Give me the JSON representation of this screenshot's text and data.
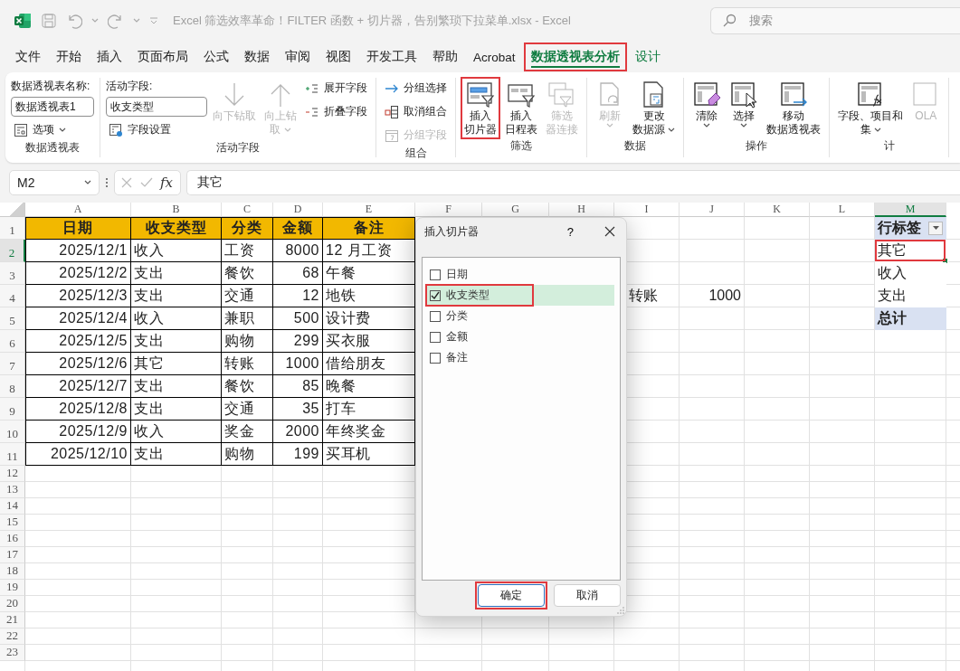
{
  "title_bar": {
    "title": "Excel 筛选效率革命！FILTER 函数 + 切片器，告别繁琐下拉菜单.xlsx  -  Excel",
    "search": {
      "placeholder": "搜索"
    }
  },
  "menu_tabs": [
    {
      "label": "文件",
      "selected": false,
      "contextual": false,
      "annotated": false
    },
    {
      "label": "开始",
      "selected": false,
      "contextual": false,
      "annotated": false
    },
    {
      "label": "插入",
      "selected": false,
      "contextual": false,
      "annotated": false
    },
    {
      "label": "页面布局",
      "selected": false,
      "contextual": false,
      "annotated": false
    },
    {
      "label": "公式",
      "selected": false,
      "contextual": false,
      "annotated": false
    },
    {
      "label": "数据",
      "selected": false,
      "contextual": false,
      "annotated": false
    },
    {
      "label": "审阅",
      "selected": false,
      "contextual": false,
      "annotated": false
    },
    {
      "label": "视图",
      "selected": false,
      "contextual": false,
      "annotated": false
    },
    {
      "label": "开发工具",
      "selected": false,
      "contextual": false,
      "annotated": false
    },
    {
      "label": "帮助",
      "selected": false,
      "contextual": false,
      "annotated": false
    },
    {
      "label": "Acrobat",
      "selected": false,
      "contextual": false,
      "annotated": false
    },
    {
      "label": "数据透视表分析",
      "selected": true,
      "contextual": true,
      "annotated": true
    },
    {
      "label": "设计",
      "selected": false,
      "contextual": true,
      "annotated": false
    }
  ],
  "ribbon": {
    "groups": [
      {
        "label": "数据透视表",
        "columns": [
          [
            {
              "kind": "caption",
              "label": "数据透视表名称:"
            },
            {
              "kind": "input",
              "value": "数据透视表1"
            },
            {
              "kind": "small",
              "label": "选项",
              "disabled": false,
              "dropdown": true
            }
          ]
        ]
      },
      {
        "label": "活动字段",
        "columns": [
          [
            {
              "kind": "caption",
              "label": "活动字段:"
            },
            {
              "kind": "input",
              "value": "收支类型"
            },
            {
              "kind": "small",
              "label": "字段设置",
              "disabled": false
            }
          ],
          [
            {
              "kind": "large",
              "lines": [
                "向下钻取"
              ],
              "disabled": true,
              "dropdown": false,
              "annotated": false
            }
          ],
          [
            {
              "kind": "large",
              "lines": [
                "向上钻",
                "取"
              ],
              "disabled": true,
              "dropdown": true,
              "annotated": false
            }
          ],
          [
            {
              "kind": "small",
              "label": "展开字段",
              "disabled": false
            },
            {
              "kind": "small",
              "label": "折叠字段",
              "disabled": false
            }
          ]
        ]
      },
      {
        "label": "组合",
        "columns": [
          [
            {
              "kind": "small",
              "label": "分组选择",
              "disabled": false
            },
            {
              "kind": "small",
              "label": "取消组合",
              "disabled": false
            },
            {
              "kind": "small",
              "label": "分组字段",
              "disabled": true
            }
          ]
        ]
      },
      {
        "label": "筛选",
        "columns": [
          [
            {
              "kind": "large",
              "lines": [
                "插入",
                "切片器"
              ],
              "disabled": false,
              "dropdown": false,
              "annotated": true
            }
          ],
          [
            {
              "kind": "large",
              "lines": [
                "插入",
                "日程表"
              ],
              "disabled": false,
              "dropdown": false,
              "annotated": false
            }
          ],
          [
            {
              "kind": "large",
              "lines": [
                "筛选",
                "器连接"
              ],
              "disabled": true,
              "dropdown": false,
              "annotated": false
            }
          ]
        ]
      },
      {
        "label": "数据",
        "columns": [
          [
            {
              "kind": "split",
              "lines": [
                "刷新"
              ],
              "disabled": true,
              "annotated": false
            }
          ],
          [
            {
              "kind": "large",
              "lines": [
                "更改",
                "数据源"
              ],
              "disabled": false,
              "dropdown": true,
              "annotated": false
            }
          ]
        ]
      },
      {
        "label": "操作",
        "columns": [
          [
            {
              "kind": "split",
              "lines": [
                "清除"
              ],
              "disabled": false,
              "annotated": false
            }
          ],
          [
            {
              "kind": "split",
              "lines": [
                "选择"
              ],
              "disabled": false,
              "annotated": false
            }
          ],
          [
            {
              "kind": "large",
              "lines": [
                "移动",
                "数据透视表"
              ],
              "disabled": false,
              "dropdown": false,
              "annotated": false
            }
          ]
        ]
      },
      {
        "label": "计",
        "columns": [
          [
            {
              "kind": "large",
              "lines": [
                "字段、项目和",
                "集"
              ],
              "disabled": false,
              "dropdown": true,
              "annotated": false
            }
          ],
          [
            {
              "kind": "large",
              "lines": [
                "OLA"
              ],
              "disabled": true,
              "dropdown": false,
              "annotated": false
            }
          ]
        ]
      }
    ]
  },
  "formula_bar": {
    "name_box": "M2",
    "function_label": "fx",
    "formula": "其它"
  },
  "sheet": {
    "columns": [
      {
        "label": "A",
        "active": false
      },
      {
        "label": "B",
        "active": false
      },
      {
        "label": "C",
        "active": false
      },
      {
        "label": "D",
        "active": false
      },
      {
        "label": "E",
        "active": false
      },
      {
        "label": "F",
        "active": false
      },
      {
        "label": "G",
        "active": false
      },
      {
        "label": "H",
        "active": false
      },
      {
        "label": "I",
        "active": false
      },
      {
        "label": "J",
        "active": false
      },
      {
        "label": "K",
        "active": false
      },
      {
        "label": "L",
        "active": false
      },
      {
        "label": "M",
        "active": true
      }
    ],
    "row_headers": [
      {
        "label": "1",
        "active": false
      },
      {
        "label": "2",
        "active": true
      },
      {
        "label": "3",
        "active": false
      },
      {
        "label": "4",
        "active": false
      },
      {
        "label": "5",
        "active": false
      },
      {
        "label": "6",
        "active": false
      },
      {
        "label": "7",
        "active": false
      },
      {
        "label": "8",
        "active": false
      },
      {
        "label": "9",
        "active": false
      },
      {
        "label": "10",
        "active": false
      },
      {
        "label": "11",
        "active": false
      },
      {
        "label": "12",
        "active": false
      },
      {
        "label": "13",
        "active": false
      },
      {
        "label": "14",
        "active": false
      },
      {
        "label": "15",
        "active": false
      },
      {
        "label": "16",
        "active": false
      },
      {
        "label": "17",
        "active": false
      },
      {
        "label": "18",
        "active": false
      },
      {
        "label": "19",
        "active": false
      },
      {
        "label": "20",
        "active": false
      },
      {
        "label": "21",
        "active": false
      },
      {
        "label": "22",
        "active": false
      },
      {
        "label": "23",
        "active": false
      }
    ],
    "table": {
      "header": [
        "日期",
        "收支类型",
        "分类",
        "金额",
        "备注"
      ],
      "rows": [
        [
          "2025/12/1",
          "收入",
          "工资",
          "8000",
          "12 月工资"
        ],
        [
          "2025/12/2",
          "支出",
          "餐饮",
          "68",
          "午餐"
        ],
        [
          "2025/12/3",
          "支出",
          "交通",
          "12",
          "地铁"
        ],
        [
          "2025/12/4",
          "收入",
          "兼职",
          "500",
          "设计费"
        ],
        [
          "2025/12/5",
          "支出",
          "购物",
          "299",
          "买衣服"
        ],
        [
          "2025/12/6",
          "其它",
          "转账",
          "1000",
          "借给朋友"
        ],
        [
          "2025/12/7",
          "支出",
          "餐饮",
          "85",
          "晚餐"
        ],
        [
          "2025/12/8",
          "支出",
          "交通",
          "35",
          "打车"
        ],
        [
          "2025/12/9",
          "收入",
          "奖金",
          "2000",
          "年终奖金"
        ],
        [
          "2025/12/10",
          "支出",
          "购物",
          "199",
          "买耳机"
        ]
      ]
    },
    "spill": [
      "转账",
      "1000"
    ],
    "pivot": {
      "header": "行标签",
      "items": [
        {
          "label": "其它",
          "selected": true,
          "annotated": true
        },
        {
          "label": "收入",
          "selected": false,
          "annotated": false
        },
        {
          "label": "支出",
          "selected": false,
          "annotated": false
        }
      ],
      "total": "总计"
    }
  },
  "dialog": {
    "title": "插入切片器",
    "help": "?",
    "fields": [
      {
        "label": "日期",
        "checked": false,
        "selected": false,
        "annotated": false
      },
      {
        "label": "收支类型",
        "checked": true,
        "selected": true,
        "annotated": true
      },
      {
        "label": "分类",
        "checked": false,
        "selected": false,
        "annotated": false
      },
      {
        "label": "金额",
        "checked": false,
        "selected": false,
        "annotated": false
      },
      {
        "label": "备注",
        "checked": false,
        "selected": false,
        "annotated": false
      }
    ],
    "buttons": [
      {
        "label": "确定",
        "default": true,
        "annotated": true
      },
      {
        "label": "取消",
        "default": false,
        "annotated": false
      }
    ]
  }
}
